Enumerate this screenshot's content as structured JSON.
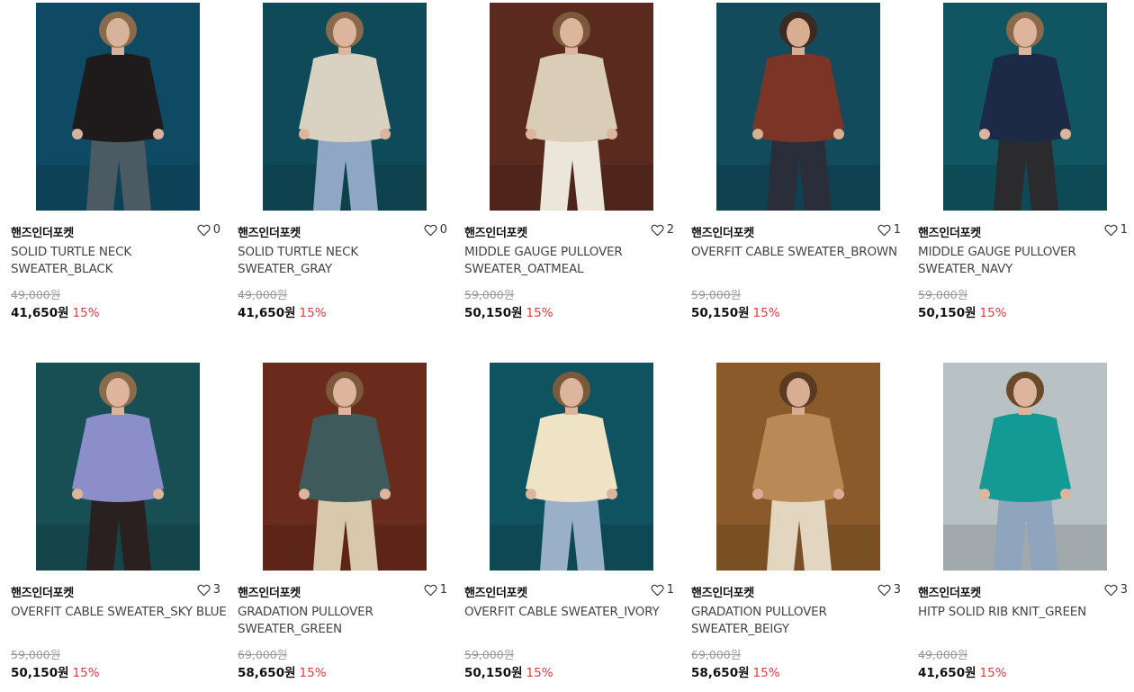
{
  "products": [
    {
      "brand": "핸즈인더포켓",
      "likes": "0",
      "name": "SOLID TURTLE NECK SWEATER_BLACK",
      "original_price": "49,000원",
      "price": "41,650원",
      "discount": "15%",
      "colors": {
        "bg": "#0e4a63",
        "garment": "#1f1b1d",
        "pants": "#4b5a63",
        "skin": "#d8b39c",
        "hair": "#8a6a4a"
      }
    },
    {
      "brand": "핸즈인더포켓",
      "likes": "0",
      "name": "SOLID TURTLE NECK SWEATER_GRAY",
      "original_price": "49,000원",
      "price": "41,650원",
      "discount": "15%",
      "colors": {
        "bg": "#0f4a58",
        "garment": "#d9d2c2",
        "pants": "#8fa7c4",
        "skin": "#dcb59c",
        "hair": "#8a6a4a"
      }
    },
    {
      "brand": "핸즈인더포켓",
      "likes": "2",
      "name": "MIDDLE GAUGE PULLOVER SWEATER_OATMEAL",
      "original_price": "59,000원",
      "price": "50,150원",
      "discount": "15%",
      "colors": {
        "bg": "#5a2a1e",
        "garment": "#d9cdb7",
        "pants": "#ece6da",
        "skin": "#dcb59c",
        "hair": "#7a5a3a"
      }
    },
    {
      "brand": "핸즈인더포켓",
      "likes": "1",
      "name": "OVERFIT CABLE SWEATER_BROWN",
      "original_price": "59,000원",
      "price": "50,150원",
      "discount": "15%",
      "colors": {
        "bg": "#134a5c",
        "garment": "#7a3526",
        "pants": "#2a2e3a",
        "skin": "#d8ad92",
        "hair": "#3a2a22"
      }
    },
    {
      "brand": "핸즈인더포켓",
      "likes": "1",
      "name": "MIDDLE GAUGE PULLOVER SWEATER_NAVY",
      "original_price": "59,000원",
      "price": "50,150원",
      "discount": "15%",
      "colors": {
        "bg": "#0f5562",
        "garment": "#1c2a45",
        "pants": "#2b2b2e",
        "skin": "#dcb59c",
        "hair": "#8a6a4a"
      }
    },
    {
      "brand": "핸즈인더포켓",
      "likes": "3",
      "name": "OVERFIT CABLE SWEATER_SKY BLUE",
      "original_price": "59,000원",
      "price": "50,150원",
      "discount": "15%",
      "colors": {
        "bg": "#174f55",
        "garment": "#8b8ec8",
        "pants": "#2a2020",
        "skin": "#dcb59c",
        "hair": "#8a6a4a"
      }
    },
    {
      "brand": "핸즈인더포켓",
      "likes": "1",
      "name": "GRADATION PULLOVER SWEATER_GREEN",
      "original_price": "69,000원",
      "price": "58,650원",
      "discount": "15%",
      "colors": {
        "bg": "#6a2a1c",
        "garment": "#3f5a5a",
        "pants": "#d8c9ad",
        "skin": "#dcb59c",
        "hair": "#7a5a3a"
      }
    },
    {
      "brand": "핸즈인더포켓",
      "likes": "1",
      "name": "OVERFIT CABLE SWEATER_IVORY",
      "original_price": "59,000원",
      "price": "50,150원",
      "discount": "15%",
      "colors": {
        "bg": "#0f5360",
        "garment": "#efe3c5",
        "pants": "#9ab0c8",
        "skin": "#dcb59c",
        "hair": "#7a5a3a"
      }
    },
    {
      "brand": "핸즈인더포켓",
      "likes": "3",
      "name": "GRADATION PULLOVER SWEATER_BEIGY",
      "original_price": "69,000원",
      "price": "58,650원",
      "discount": "15%",
      "colors": {
        "bg": "#8a5a2a",
        "garment": "#b98a55",
        "pants": "#e2d6c0",
        "skin": "#d8ad92",
        "hair": "#5a3a22"
      }
    },
    {
      "brand": "핸즈인더포켓",
      "likes": "3",
      "name": "HITP SOLID RIB KNIT_GREEN",
      "original_price": "49,000원",
      "price": "41,650원",
      "discount": "15%",
      "colors": {
        "bg": "#b8c1c4",
        "garment": "#149a94",
        "pants": "#8fa5bd",
        "skin": "#dcb59c",
        "hair": "#6a4a2a"
      }
    }
  ],
  "heart_icon": "heart-outline-icon"
}
